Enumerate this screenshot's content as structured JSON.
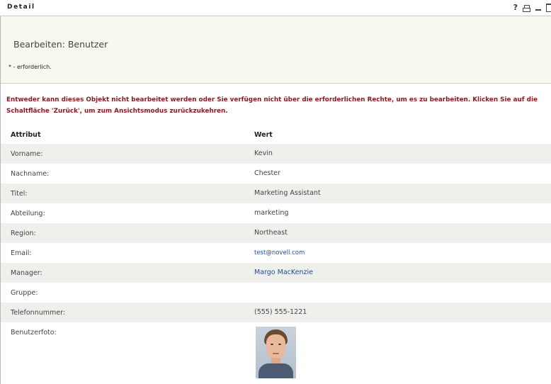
{
  "window": {
    "title": "Detail",
    "help_label": "?"
  },
  "header": {
    "title": "Bearbeiten: Benutzer",
    "required_note": "* - erforderlich."
  },
  "error_message": "Entweder kann dieses Objekt nicht bearbeitet werden oder Sie verfügen nicht über die erforderlichen Rechte, um es zu bearbeiten. Klicken Sie auf die Schaltfläche 'Zurück', um zum Ansichtsmodus zurückzukehren.",
  "table": {
    "col_attr": "Attribut",
    "col_value": "Wert",
    "rows": [
      {
        "attr": "Vorname:",
        "value": "Kevin"
      },
      {
        "attr": "Nachname:",
        "value": "Chester"
      },
      {
        "attr": "Titel:",
        "value": "Marketing Assistant"
      },
      {
        "attr": "Abteilung:",
        "value": "marketing"
      },
      {
        "attr": "Region:",
        "value": "Northeast"
      },
      {
        "attr": "Email:",
        "value": "test@novell.com"
      },
      {
        "attr": "Manager:",
        "value": "Margo MacKenzie"
      },
      {
        "attr": "Gruppe:",
        "value": ""
      },
      {
        "attr": "Telefonnummer:",
        "value": "(555) 555-1221"
      },
      {
        "attr": "Benutzerfoto:",
        "value": ""
      }
    ]
  },
  "icons": {
    "help": "help-icon",
    "print": "printer-icon",
    "minimize": "minimize-icon",
    "maximize": "maximize-icon"
  },
  "colors": {
    "error_text": "#8b1a1a",
    "link": "#1f4e96",
    "header_bg": "#f7f8ef",
    "row_alt_bg": "#efefeb"
  }
}
